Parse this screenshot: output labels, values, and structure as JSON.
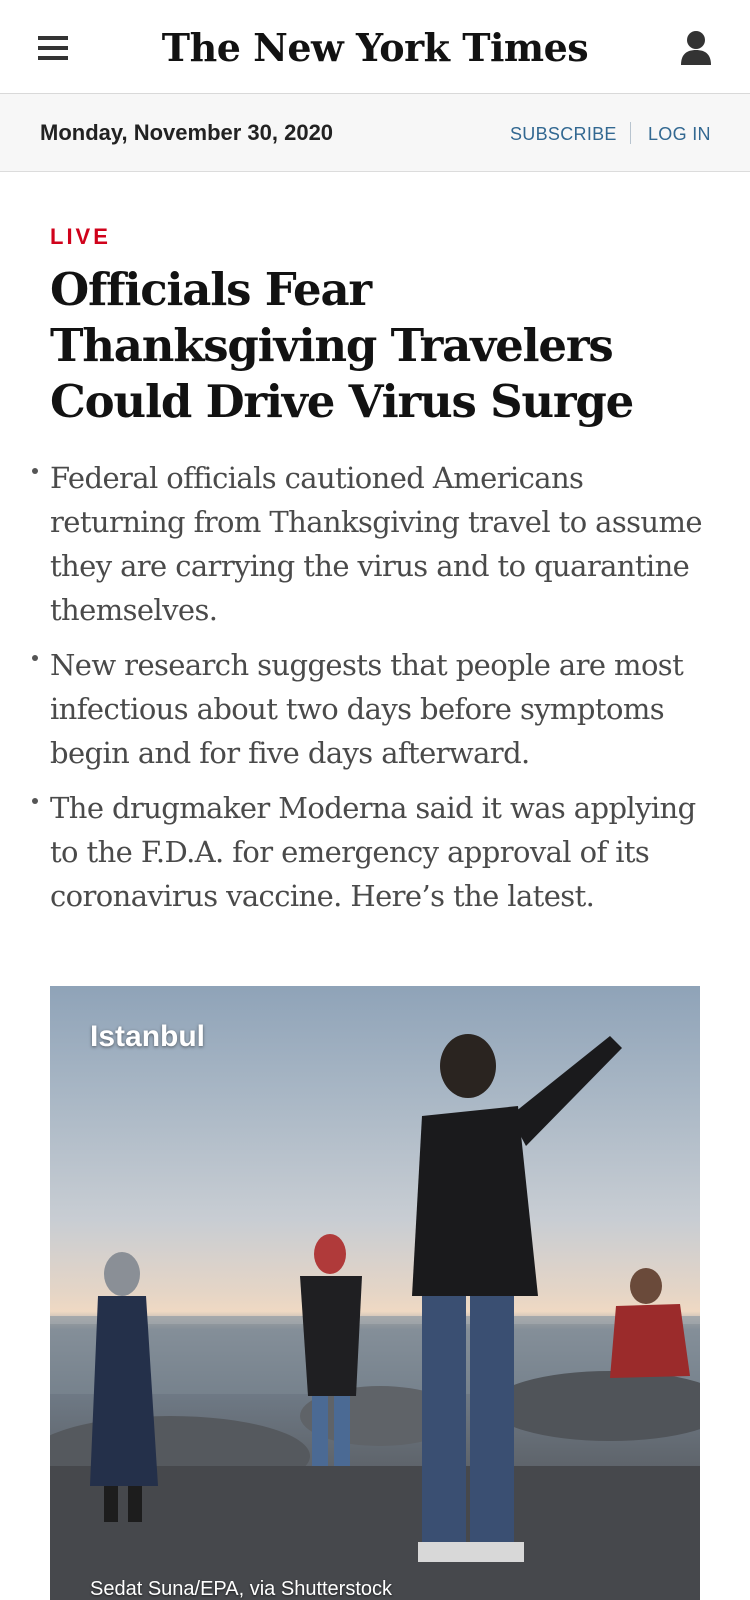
{
  "header": {
    "logo_text": "The New York Times",
    "menu_icon": "hamburger-menu-icon",
    "user_icon": "user-account-icon"
  },
  "datebar": {
    "date": "Monday, November 30, 2020",
    "subscribe_label": "SUBSCRIBE",
    "login_label": "LOG IN"
  },
  "article": {
    "kicker": "LIVE",
    "headline": "Officials Fear Thanksgiving Travelers Could Drive Virus Surge",
    "bullets": [
      "Federal officials cautioned Americans returning from Thanksgiving travel to assume they are carrying the virus and to quarantine themselves.",
      "New research suggests that people are most infectious about two days before symptoms begin and for five days afterward.",
      "The drugmaker Moderna said it was applying to the F.D.A. for emergency approval of its coronavirus vaccine. Here’s the latest."
    ],
    "photo": {
      "location_label": "Istanbul",
      "credit": "Sedat Suna/EPA, via Shutterstock"
    }
  },
  "colors": {
    "live_red": "#d0021b",
    "link_blue": "#326891",
    "text_dark": "#121212",
    "bullet_gray": "#4a4a4a",
    "datebar_bg": "#f7f7f7"
  }
}
